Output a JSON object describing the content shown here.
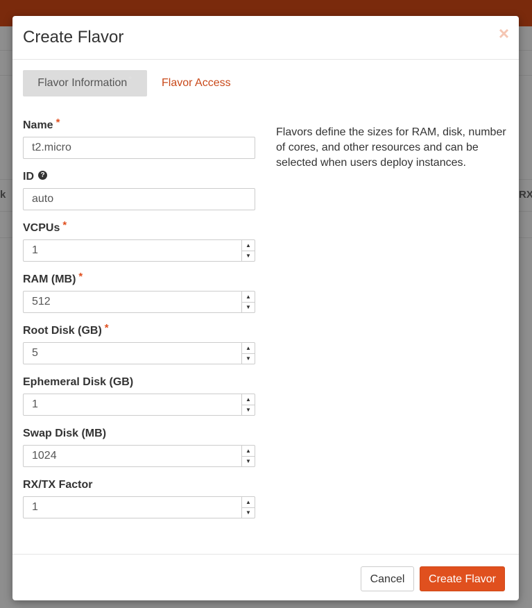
{
  "background": {
    "left_fragment": "k",
    "right_fragment": "RX/T"
  },
  "modal": {
    "title": "Create Flavor",
    "close_symbol": "×",
    "tabs": [
      {
        "label": "Flavor Information",
        "active": true,
        "marker": "*"
      },
      {
        "label": "Flavor Access",
        "active": false
      }
    ],
    "fields": {
      "name": {
        "label": "Name",
        "required": true,
        "value": "t2.micro"
      },
      "id": {
        "label": "ID",
        "help": "?",
        "value": "auto"
      },
      "vcpus": {
        "label": "VCPUs",
        "required": true,
        "value": "1"
      },
      "ram": {
        "label": "RAM (MB)",
        "required": true,
        "value": "512"
      },
      "root_disk": {
        "label": "Root Disk (GB)",
        "required": true,
        "value": "5"
      },
      "ephemeral_disk": {
        "label": "Ephemeral Disk (GB)",
        "value": "1"
      },
      "swap_disk": {
        "label": "Swap Disk (MB)",
        "value": "1024"
      },
      "rxtx_factor": {
        "label": "RX/TX Factor",
        "value": "1"
      }
    },
    "required_marker": "*",
    "description": "Flavors define the sizes for RAM, disk, number of cores, and other resources and can be selected when users deploy instances.",
    "footer": {
      "cancel_label": "Cancel",
      "submit_label": "Create Flavor"
    }
  },
  "colors": {
    "accent": "#e0501e",
    "link": "#c9491a",
    "topbar": "#7a2a0c"
  }
}
